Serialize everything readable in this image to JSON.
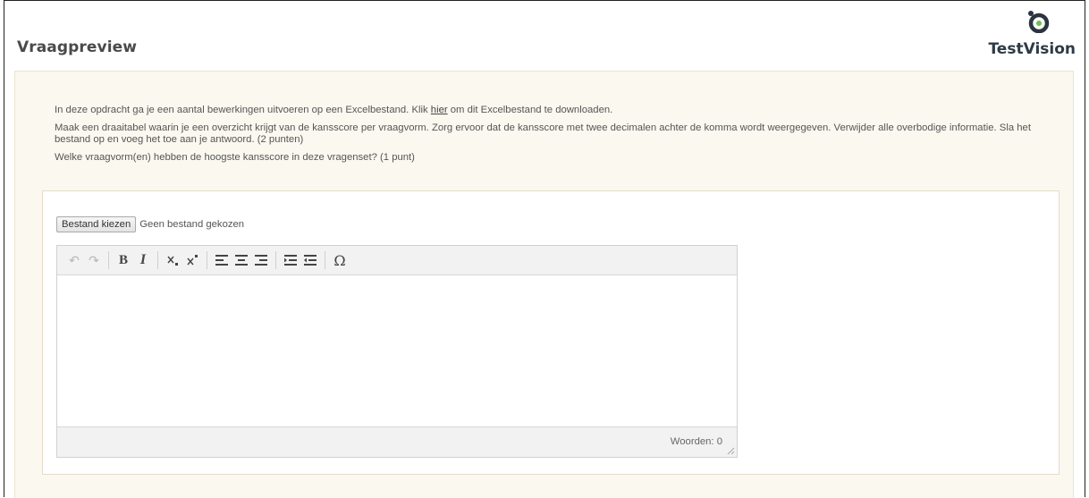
{
  "header": {
    "title": "Vraagpreview",
    "logo_text": "TestVision"
  },
  "colors": {
    "content_background": "#fbf8ef",
    "logo_text": "#2f3a45",
    "logo_mark": "#2a3540",
    "logo_dot": "#6fc04f"
  },
  "question": {
    "paragraph_1_before": "In deze opdracht ga je een aantal bewerkingen uitvoeren op een Excelbestand. Klik ",
    "paragraph_1_link": "hier",
    "paragraph_1_after": " om dit Excelbestand te downloaden.",
    "paragraph_2": "Maak een draaitabel waarin je een overzicht krijgt van de kansscore per vraagvorm. Zorg ervoor dat de kansscore met twee decimalen achter de komma wordt weergegeven. Verwijder alle overbodige informatie. Sla het bestand op en voeg het toe aan je antwoord. (2 punten)",
    "paragraph_3": "Welke vraagvorm(en) hebben de hoogste kansscore in deze vragenset? (1 punt)"
  },
  "file_upload": {
    "button_label": "Bestand kiezen",
    "status": "Geen bestand gekozen"
  },
  "toolbar": {
    "undo": "↶",
    "redo": "↷",
    "bold": "B",
    "italic": "I",
    "omega": "Ω"
  },
  "editor": {
    "word_count": "Woorden: 0"
  }
}
